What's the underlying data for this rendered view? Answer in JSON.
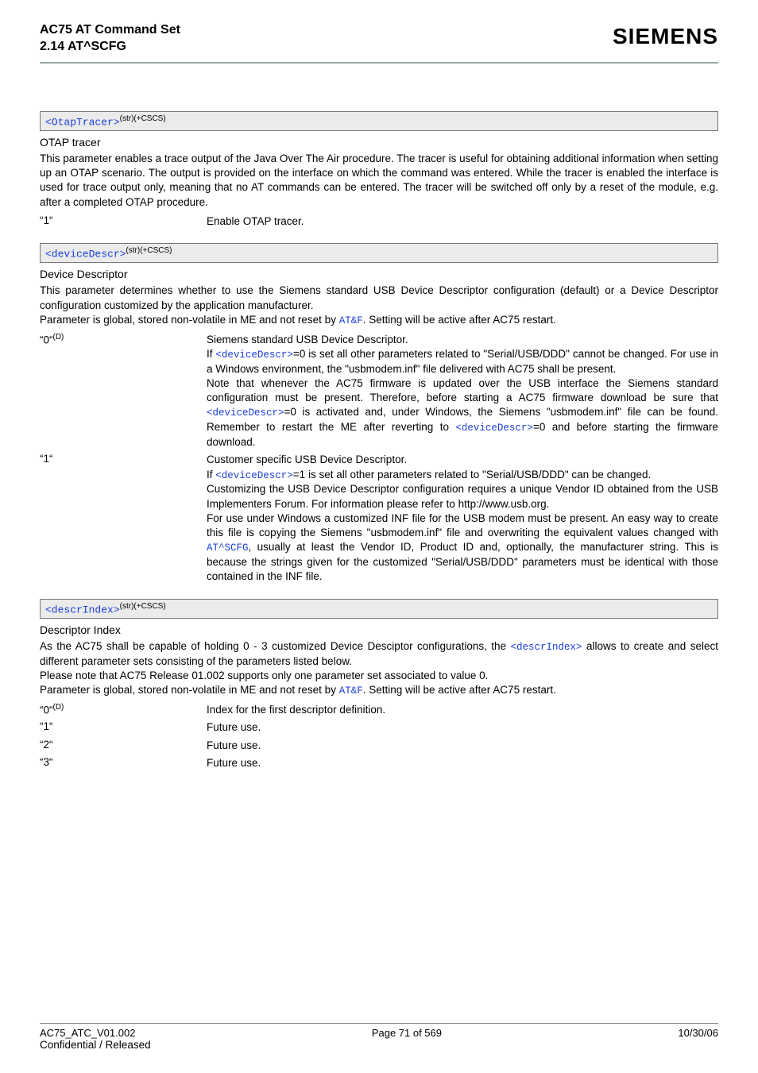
{
  "header": {
    "doc_title": "AC75 AT Command Set",
    "section_ref": "2.14 AT^SCFG",
    "brand": "SIEMENS"
  },
  "params": [
    {
      "name": "<OtapTracer>",
      "sup": "(str)(+CSCS)",
      "title": "OTAP tracer",
      "intro": "This parameter enables a trace output of the Java Over The Air procedure. The tracer is useful for obtaining additional information when setting up an OTAP scenario. The output is provided on the interface on which the command was entered. While the tracer is enabled the interface is used for trace output only, meaning that no AT commands can be entered. The tracer will be switched off only by a reset of the module, e.g. after a completed OTAP procedure.",
      "values": [
        {
          "key": "“1“",
          "desc": "Enable OTAP tracer."
        }
      ]
    },
    {
      "name": "<deviceDescr>",
      "sup": "(str)(+CSCS)",
      "title": "Device Descriptor",
      "intro_parts": {
        "p1": "This parameter determines whether to use the Siemens standard USB Device Descriptor configuration (default) or a Device Descriptor configuration customized by the application manufacturer.",
        "p2a": "Parameter is global, stored non-volatile in ME and not reset by ",
        "p2_link": "AT&F",
        "p2b": ". Setting will be active after AC75 restart."
      },
      "values": [
        {
          "key": "“0“",
          "key_sup": "(D)",
          "parts": {
            "a": "Siemens standard USB Device Descriptor.",
            "b1": "If ",
            "b_link1": "<deviceDescr>",
            "b2": "=0 is set all other parameters related to \"Serial/USB/DDD\" cannot be changed. For use in a Windows environment, the \"usbmodem.inf\" file delivered with AC75 shall be present.",
            "c1": "Note that whenever the AC75 firmware is updated over the USB interface the Siemens standard configuration must be present. Therefore, before starting a AC75 firmware download be sure that ",
            "c_link1": "<deviceDescr>",
            "c2": "=0 is activated and, under Windows, the Siemens \"usbmodem.inf\" file can be found. Remember to restart the ME after reverting to ",
            "c_link2": "<deviceDescr>",
            "c3": "=0 and before starting the firmware download."
          }
        },
        {
          "key": "“1“",
          "parts": {
            "a": "Customer specific USB Device Descriptor.",
            "b1": "If ",
            "b_link1": "<deviceDescr>",
            "b2": "=1 is set all other parameters related to \"Serial/USB/DDD\" can be changed.",
            "c": "Customizing the USB Device Descriptor configuration requires a unique Vendor ID obtained from the USB Implementers Forum. For information please refer to http://www.usb.org.",
            "d1": "For use under Windows a customized INF file for the USB modem must be present. An easy way to create this file is copying the Siemens \"usbmodem.inf\" file and overwriting the equivalent values changed with ",
            "d_link1": "AT^SCFG",
            "d2": ", usually at least the Vendor ID, Product ID and, optionally, the manufacturer string. This is because the strings given for the customized \"Serial/USB/DDD\" parameters must be identical with those contained in the INF file."
          }
        }
      ]
    },
    {
      "name": "<descrIndex>",
      "sup": "(str)(+CSCS)",
      "title": "Descriptor Index",
      "intro_parts": {
        "p1a": "As the AC75 shall be capable of holding 0 - 3 customized Device Desciptor configurations, the ",
        "p1_link": "<descrIndex>",
        "p1b": " allows to create and select different parameter sets consisting of the parameters listed below.",
        "p2": "Please note that AC75 Release 01.002 supports only one parameter set associated to value 0.",
        "p3a": "Parameter is global, stored non-volatile in ME and not reset by ",
        "p3_link": "AT&F",
        "p3b": ". Setting will be active after AC75 restart."
      },
      "values": [
        {
          "key": "“0“",
          "key_sup": "(D)",
          "desc": "Index for the first descriptor definition."
        },
        {
          "key": "“1“",
          "desc": "Future use."
        },
        {
          "key": "“2“",
          "desc": "Future use."
        },
        {
          "key": "“3“",
          "desc": "Future use."
        }
      ]
    }
  ],
  "footer": {
    "left1": "AC75_ATC_V01.002",
    "left2": "Confidential / Released",
    "center": "Page 71 of 569",
    "right": "10/30/06"
  }
}
